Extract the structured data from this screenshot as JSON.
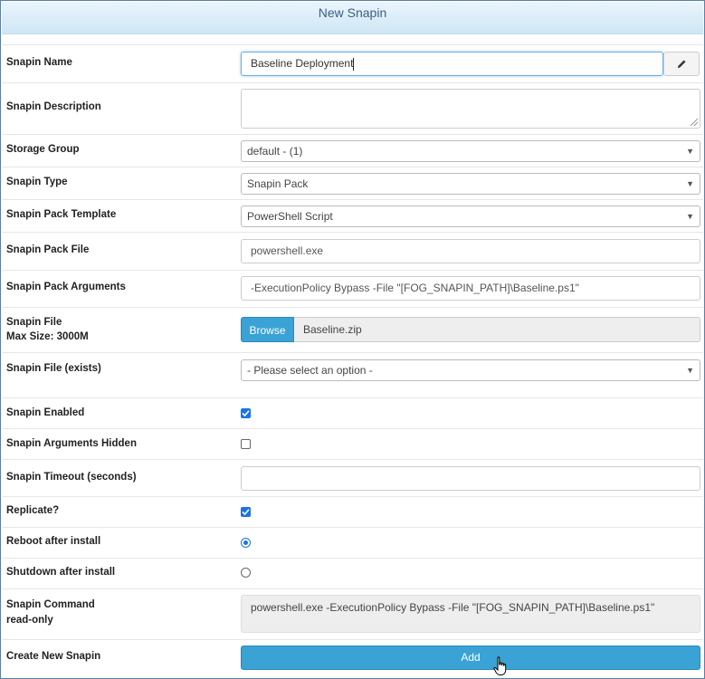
{
  "header": {
    "title": "New Snapin"
  },
  "fields": {
    "snapin_name": {
      "label": "Snapin Name",
      "value": "Baseline Deployment"
    },
    "snapin_description": {
      "label": "Snapin Description",
      "value": ""
    },
    "storage_group": {
      "label": "Storage Group",
      "value": "default - (1)"
    },
    "snapin_type": {
      "label": "Snapin Type",
      "value": "Snapin Pack"
    },
    "snapin_pack_template": {
      "label": "Snapin Pack Template",
      "value": "PowerShell Script"
    },
    "snapin_pack_file": {
      "label": "Snapin Pack File",
      "value": "powershell.exe"
    },
    "snapin_pack_arguments": {
      "label": "Snapin Pack Arguments",
      "value": "-ExecutionPolicy Bypass -File \"[FOG_SNAPIN_PATH]\\Baseline.ps1\""
    },
    "snapin_file": {
      "label": "Snapin File",
      "sublabel": "Max Size: 3000M",
      "browse_label": "Browse",
      "filename": "Baseline.zip"
    },
    "snapin_file_exists": {
      "label": "Snapin File (exists)",
      "value": "- Please select an option -"
    },
    "snapin_enabled": {
      "label": "Snapin Enabled",
      "checked": true
    },
    "snapin_arguments_hidden": {
      "label": "Snapin Arguments Hidden",
      "checked": false
    },
    "snapin_timeout": {
      "label": "Snapin Timeout (seconds)",
      "value": ""
    },
    "replicate": {
      "label": "Replicate?",
      "checked": true
    },
    "reboot_after_install": {
      "label": "Reboot after install",
      "selected": true
    },
    "shutdown_after_install": {
      "label": "Shutdown after install",
      "selected": false
    },
    "snapin_command": {
      "label": "Snapin Command",
      "sublabel": "read-only",
      "value": "powershell.exe -ExecutionPolicy Bypass -File \"[FOG_SNAPIN_PATH]\\Baseline.ps1\""
    },
    "create_new_snapin": {
      "label": "Create New Snapin",
      "button_label": "Add"
    }
  },
  "icons": {
    "edit": "pencil-icon",
    "dropdown": "caret-down-icon",
    "cursor": "hand-pointer-icon"
  },
  "colors": {
    "accent": "#3aa2d4",
    "checkbox": "#1a73e8",
    "header_text": "#3b5f82"
  }
}
